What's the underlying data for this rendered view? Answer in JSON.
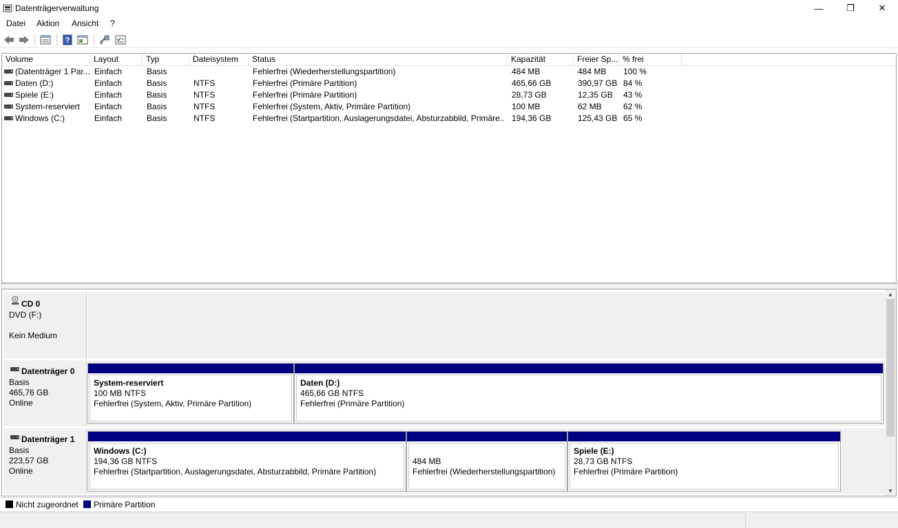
{
  "window": {
    "title": "Datenträgerverwaltung",
    "min_glyph": "—",
    "max_glyph": "❐",
    "close_glyph": "✕"
  },
  "menu": {
    "items": [
      "Datei",
      "Aktion",
      "Ansicht",
      "?"
    ]
  },
  "toolbar": {
    "icons": [
      "back-arrow-icon",
      "forward-arrow-icon",
      "properties-list-icon",
      "help-icon",
      "help-topics-icon",
      "connect-icon",
      "check-list-icon"
    ]
  },
  "volume_list": {
    "columns": [
      "Volume",
      "Layout",
      "Typ",
      "Dateisystem",
      "Status",
      "Kapazität",
      "Freier Sp...",
      "% frei"
    ],
    "rows": [
      [
        "(Datenträger 1 Par...",
        "Einfach",
        "Basis",
        "",
        "Fehlerfrei (Wiederherstellungspartition)",
        "484 MB",
        "484 MB",
        "100 %"
      ],
      [
        "Daten (D:)",
        "Einfach",
        "Basis",
        "NTFS",
        "Fehlerfrei (Primäre Partition)",
        "465,66 GB",
        "390,97 GB",
        "84 %"
      ],
      [
        "Spiele (E:)",
        "Einfach",
        "Basis",
        "NTFS",
        "Fehlerfrei (Primäre Partition)",
        "28,73 GB",
        "12,35 GB",
        "43 %"
      ],
      [
        "System-reserviert",
        "Einfach",
        "Basis",
        "NTFS",
        "Fehlerfrei (System, Aktiv, Primäre Partition)",
        "100 MB",
        "62 MB",
        "62 %"
      ],
      [
        "Windows (C:)",
        "Einfach",
        "Basis",
        "NTFS",
        "Fehlerfrei (Startpartition, Auslagerungsdatei, Absturzabbild, Primäre...",
        "194,36 GB",
        "125,43 GB",
        "65 %"
      ]
    ]
  },
  "disks": {
    "cd0": {
      "name": "CD 0",
      "line1": "DVD (F:)",
      "line2": "Kein Medium"
    },
    "disk0": {
      "name": "Datenträger 0",
      "type": "Basis",
      "size": "465,76 GB",
      "state": "Online",
      "partitions": [
        {
          "title": "System-reserviert",
          "size": "100 MB NTFS",
          "status": "Fehlerfrei (System, Aktiv, Primäre Partition)"
        },
        {
          "title": "Daten  (D:)",
          "size": "465,66 GB NTFS",
          "status": "Fehlerfrei (Primäre Partition)"
        }
      ]
    },
    "disk1": {
      "name": "Datenträger 1",
      "type": "Basis",
      "size": "223,57 GB",
      "state": "Online",
      "partitions": [
        {
          "title": "Windows  (C:)",
          "size": "194,36 GB NTFS",
          "status": "Fehlerfrei (Startpartition, Auslagerungsdatei, Absturzabbild, Primäre Partition)"
        },
        {
          "title": "",
          "size": "484 MB",
          "status": "Fehlerfrei (Wiederherstellungspartition)"
        },
        {
          "title": "Spiele  (E:)",
          "size": "28,73 GB NTFS",
          "status": "Fehlerfrei (Primäre Partition)"
        }
      ]
    }
  },
  "legend": {
    "unallocated": "Nicht zugeordnet",
    "primary": "Primäre Partition",
    "unallocated_color": "#000000",
    "primary_color": "#000080"
  }
}
